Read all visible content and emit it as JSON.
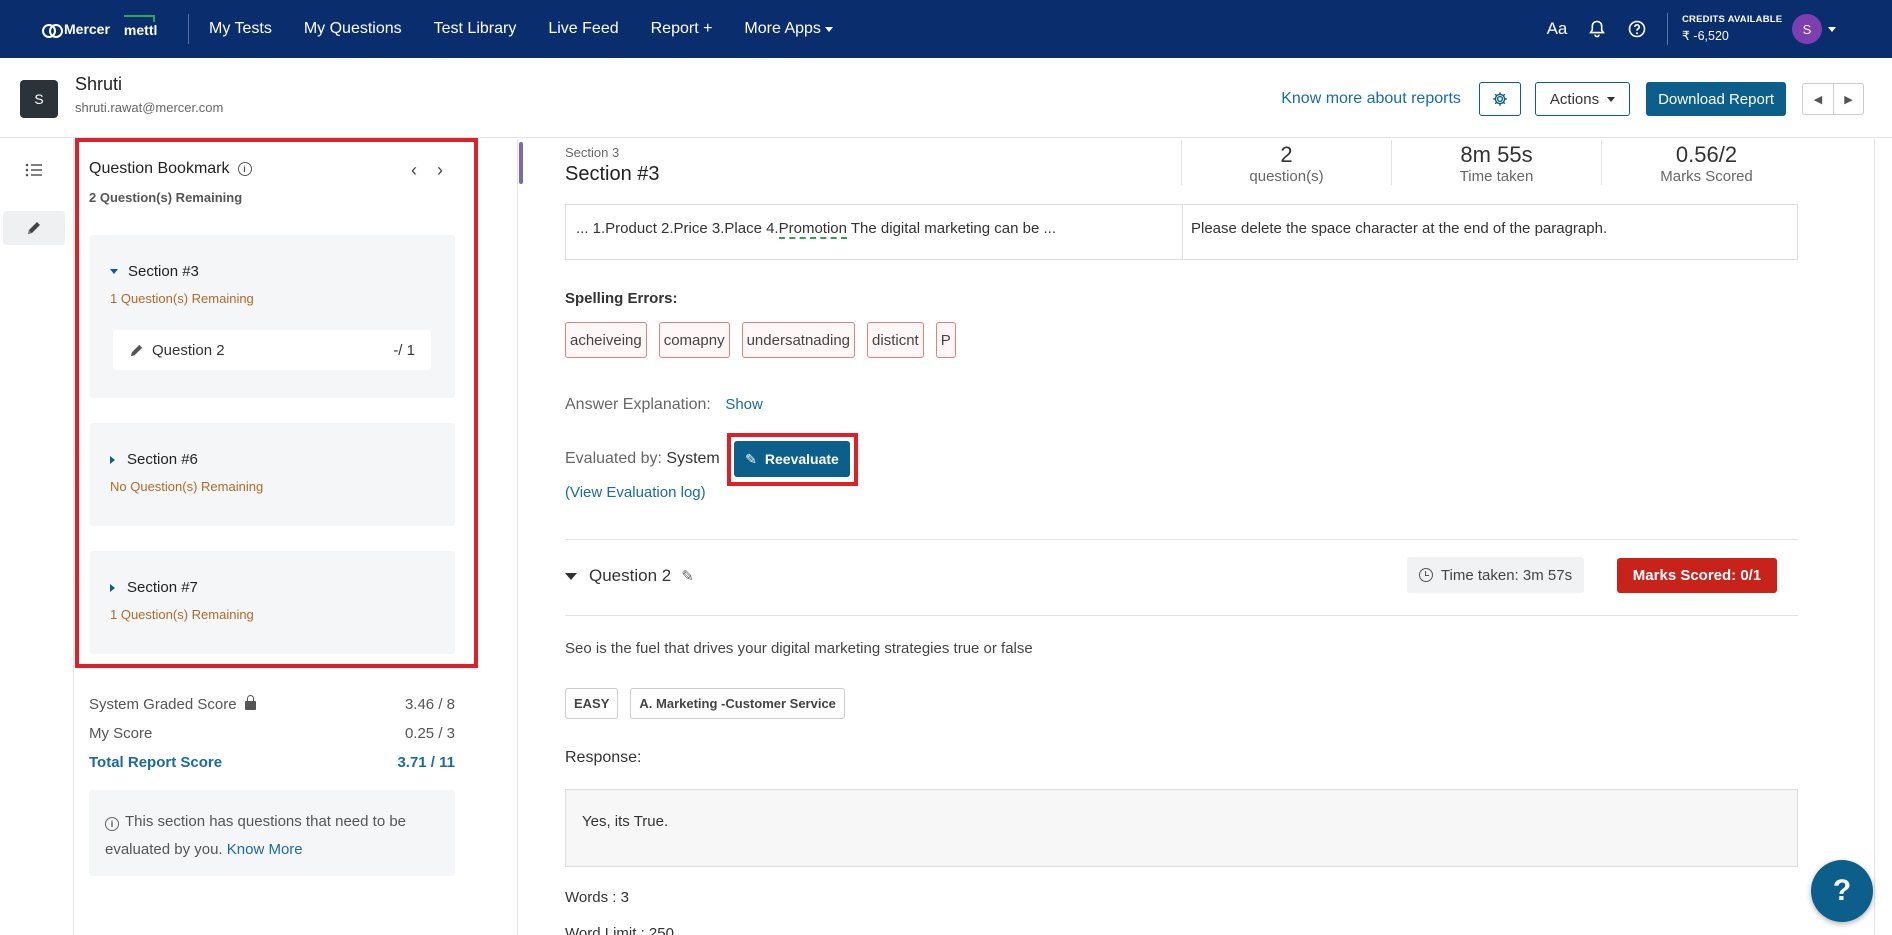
{
  "topnav": {
    "brand": "Mercer",
    "sub_brand": "mettl",
    "links": [
      "My Tests",
      "My Questions",
      "Test Library",
      "Live Feed",
      "Report +",
      "More Apps"
    ],
    "font_icon": "Aa",
    "credits_label": "CREDITS AVAILABLE",
    "credits_value": "₹ -6,520",
    "avatar_initial": "S"
  },
  "header": {
    "avatar_initial": "S",
    "name": "Shruti",
    "email": "shruti.rawat@mercer.com",
    "know_more": "Know more about reports",
    "actions": "Actions",
    "download": "Download Report"
  },
  "bookmark": {
    "title": "Question Bookmark",
    "remaining": "2 Question(s) Remaining",
    "sections": [
      {
        "name": "Section #3",
        "remaining": "1 Question(s) Remaining",
        "question_label": "Question 2",
        "question_score": "-/ 1"
      },
      {
        "name": "Section #6",
        "remaining": "No Question(s) Remaining"
      },
      {
        "name": "Section #7",
        "remaining": "1 Question(s) Remaining"
      }
    ]
  },
  "scores": {
    "system_label": "System Graded Score",
    "system_value": "3.46 / 8",
    "my_label": "My Score",
    "my_value": "0.25 / 3",
    "total_label": "Total Report Score",
    "total_value": "3.71 / 11"
  },
  "note": {
    "text": "This section has questions that need to be evaluated by you.",
    "link": "Know More"
  },
  "section": {
    "small_label": "Section 3",
    "title": "Section #3",
    "stats": [
      {
        "value": "2",
        "label": "question(s)"
      },
      {
        "value": "8m 55s",
        "label": "Time taken"
      },
      {
        "value": "0.56/2",
        "label": "Marks Scored"
      }
    ]
  },
  "grammar": {
    "snippet_before": "... 1.Product 2.Price 3.Place 4.",
    "snippet_mark": "Promotion",
    "snippet_after": " The digital marketing can be ...",
    "suggestion": "Please delete the space character at the end of the paragraph."
  },
  "spelling": {
    "title": "Spelling Errors:",
    "errors": [
      "acheiveing",
      "comapny",
      "undersatnading",
      "disticnt",
      "P"
    ]
  },
  "answer_explanation": {
    "label": "Answer Explanation:",
    "show": "Show"
  },
  "evaluation": {
    "label": "Evaluated by:",
    "by": "System",
    "reevaluate": "Reevaluate",
    "view_log": "(View Evaluation log)"
  },
  "question2": {
    "title": "Question 2",
    "time_taken": "Time taken: 3m 57s",
    "marks_scored": "Marks Scored: 0/1",
    "text": "Seo is the fuel that drives your digital marketing strategies true or false",
    "tags": [
      "EASY",
      "A. Marketing -Customer Service"
    ],
    "response_label": "Response:",
    "response": "Yes, its True.",
    "words": "Words : 3",
    "word_limit": "Word Limit : 250"
  },
  "help_fab": "?",
  "colors": {
    "navbar": "#0a2d6e",
    "primary": "#0b5f8a",
    "link": "#1b6aa5",
    "danger": "#c8231b",
    "highlight_box": "#e02028",
    "remaining_text": "#b06a2a"
  }
}
